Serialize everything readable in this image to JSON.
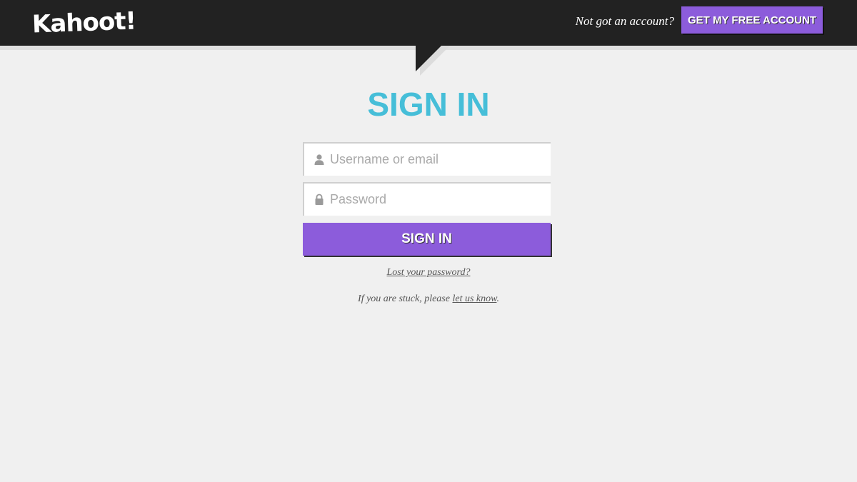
{
  "header": {
    "logo_text": "Kahoot!",
    "account_prompt": "Not got an account?",
    "free_account_label": "GET MY FREE ACCOUNT"
  },
  "main": {
    "title": "SIGN IN",
    "username": {
      "value": "",
      "placeholder": "Username or email",
      "icon": "user-icon"
    },
    "password": {
      "value": "",
      "placeholder": "Password",
      "icon": "lock-icon"
    },
    "signin_label": "SIGN IN",
    "lost_password": "Lost your password?",
    "stuck_prefix": "If you are stuck, please ",
    "stuck_link": "let us know",
    "stuck_suffix": "."
  },
  "colors": {
    "header_bg": "#222222",
    "page_bg": "#f0f0f0",
    "accent_purple": "#8c5cdb",
    "title_blue": "#46bed8"
  }
}
